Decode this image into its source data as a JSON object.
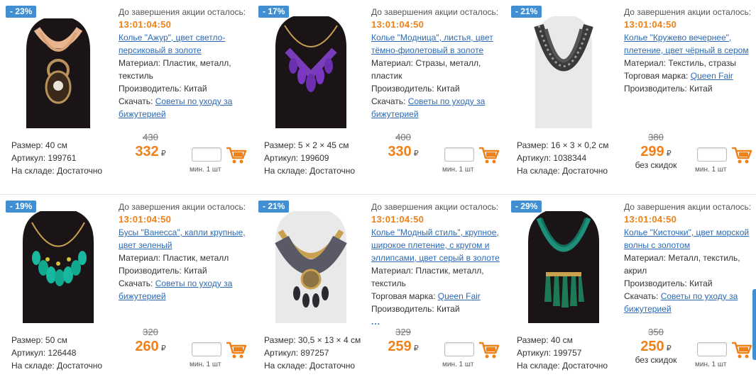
{
  "timer_label": "До завершения акции осталось:",
  "timer_value": "13:01:04:50",
  "currency": "₽",
  "min_label": "мин. 1 шт",
  "colors": {
    "accent": "#f08018",
    "badge": "#3f8fd2",
    "link": "#2b6ab3"
  },
  "products": [
    {
      "discount": "- 23%",
      "title": "Колье \"Ажур\", цвет светло-персиковый в золоте",
      "material_key": "Материал:",
      "material": "Пластик, металл, текстиль",
      "brand_key": "",
      "brand": "",
      "maker_key": "Производитель:",
      "maker": "Китай",
      "download_key": "Скачать:",
      "download": "Советы по уходу за бижутерией",
      "more": "",
      "size": "Размер: 40 см",
      "article": "Артикул: 199761",
      "stock": "На складе: Достаточно",
      "old_price": "430",
      "price": "332",
      "no_discount": ""
    },
    {
      "discount": "- 17%",
      "title": "Колье \"Модница\", листья, цвет тёмно-фиолетовый в золоте",
      "material_key": "Материал:",
      "material": "Стразы, металл, пластик",
      "brand_key": "",
      "brand": "",
      "maker_key": "Производитель:",
      "maker": "Китай",
      "download_key": "Скачать:",
      "download": "Советы по уходу за бижутерией",
      "more": "",
      "size": "Размер: 5 × 2 × 45 см",
      "article": "Артикул: 199609",
      "stock": "На складе: Достаточно",
      "old_price": "400",
      "price": "330",
      "no_discount": ""
    },
    {
      "discount": "- 21%",
      "title": "Колье \"Кружево вечернее\", плетение, цвет чёрный в сером",
      "material_key": "Материал:",
      "material": "Текстиль, стразы",
      "brand_key": "Торговая марка:",
      "brand": "Queen Fair",
      "maker_key": "Производитель:",
      "maker": "Китай",
      "download_key": "",
      "download": "",
      "more": "",
      "size": "Размер: 16 × 3 × 0,2 см",
      "article": "Артикул: 1038344",
      "stock": "На складе: Достаточно",
      "old_price": "380",
      "price": "299",
      "no_discount": "без скидок"
    },
    {
      "discount": "- 19%",
      "title": "Бусы \"Ванесса\", капли крупные, цвет зеленый",
      "material_key": "Материал:",
      "material": "Пластик, металл",
      "brand_key": "",
      "brand": "",
      "maker_key": "Производитель:",
      "maker": "Китай",
      "download_key": "Скачать:",
      "download": "Советы по уходу за бижутерией",
      "more": "",
      "size": "Размер: 50 см",
      "article": "Артикул: 126448",
      "stock": "На складе: Достаточно",
      "old_price": "320",
      "price": "260",
      "no_discount": ""
    },
    {
      "discount": "- 21%",
      "title": "Колье \"Модный стиль\", крупное, широкое плетение, с кругом и эллипсами, цвет серый в золоте",
      "material_key": "Материал:",
      "material": "Пластик, металл, текстиль",
      "brand_key": "Торговая марка:",
      "brand": "Queen Fair",
      "maker_key": "Производитель:",
      "maker": "Китай",
      "download_key": "",
      "download": "",
      "more": "...",
      "size": "Размер: 30,5 × 13 × 4 см",
      "article": "Артикул: 897257",
      "stock": "На складе: Достаточно",
      "old_price": "329",
      "price": "259",
      "no_discount": ""
    },
    {
      "discount": "- 29%",
      "title": "Колье \"Кисточки\", цвет морской волны с золотом",
      "material_key": "Материал:",
      "material": "Металл, текстиль, акрил",
      "brand_key": "",
      "brand": "",
      "maker_key": "Производитель:",
      "maker": "Китай",
      "download_key": "Скачать:",
      "download": "Советы по уходу за бижутерией",
      "more": "",
      "size": "Размер: 40 см",
      "article": "Артикул: 199757",
      "stock": "На складе: Достаточно",
      "old_price": "350",
      "price": "250",
      "no_discount": "без скидок"
    }
  ]
}
